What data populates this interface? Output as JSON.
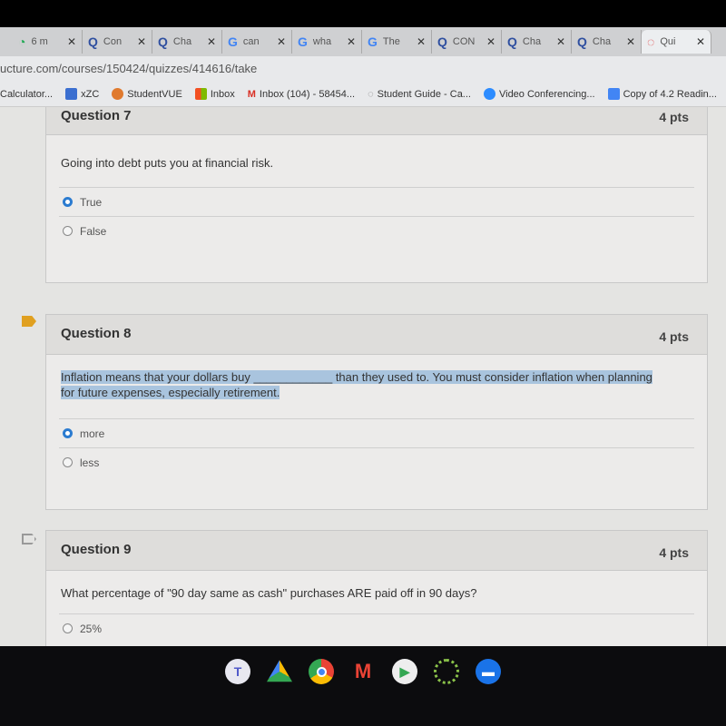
{
  "browser": {
    "tabs": [
      {
        "label": "6 m",
        "icon": "github-icon"
      },
      {
        "label": "Con",
        "icon": "quizlet-icon"
      },
      {
        "label": "Cha",
        "icon": "quizlet-icon"
      },
      {
        "label": "can",
        "icon": "google-icon"
      },
      {
        "label": "wha",
        "icon": "google-icon"
      },
      {
        "label": "The",
        "icon": "google-icon"
      },
      {
        "label": "CON",
        "icon": "quizlet-icon"
      },
      {
        "label": "Cha",
        "icon": "quizlet-icon"
      },
      {
        "label": "Cha",
        "icon": "quizlet-icon"
      },
      {
        "label": "Qui",
        "icon": "canvas-icon",
        "active": true
      }
    ],
    "url": "ucture.com/courses/150424/quizzes/414616/take",
    "bookmarks": [
      {
        "label": "Calculator..."
      },
      {
        "label": "xZC",
        "color": "#3b6fd0"
      },
      {
        "label": "StudentVUE",
        "color": "#e07a2e"
      },
      {
        "label": "Inbox",
        "color": "#f25022"
      },
      {
        "label": "Inbox (104) - 58454...",
        "color": "#d93025"
      },
      {
        "label": "Student Guide - Ca...",
        "color": "#999999"
      },
      {
        "label": "Video Conferencing...",
        "color": "#2d8cff"
      },
      {
        "label": "Copy of 4.2 Readin...",
        "color": "#4285f4"
      }
    ]
  },
  "questions": [
    {
      "title": "Question 7",
      "points": "4 pts",
      "text": "Going into debt puts you at financial risk.",
      "answers": [
        {
          "label": "True",
          "selected": true
        },
        {
          "label": "False",
          "selected": false
        }
      ]
    },
    {
      "title": "Question 8",
      "points": "4 pts",
      "text_a": "Inflation means that your dollars buy ____________ than they used to.  You must consider inflation when planning",
      "text_b": "for future expenses, especially retirement.",
      "answers": [
        {
          "label": "more",
          "selected": true
        },
        {
          "label": "less",
          "selected": false
        }
      ]
    },
    {
      "title": "Question 9",
      "points": "4 pts",
      "text": "What percentage of \"90 day same as cash\" purchases ARE paid off in 90 days?",
      "answers": [
        {
          "label": "25%",
          "selected": false
        }
      ]
    }
  ],
  "taskbar": [
    "teams-icon",
    "drive-icon",
    "chrome-icon",
    "gmail-icon",
    "play-store-icon",
    "launcher-icon",
    "files-icon"
  ],
  "colors": {
    "accent": "#2b7bd0",
    "flag": "#e0a020",
    "highlight": "#a9c4de"
  }
}
